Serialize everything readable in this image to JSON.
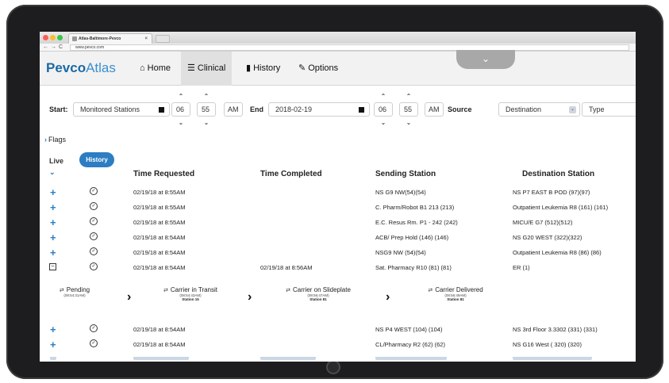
{
  "browser": {
    "tab_title": "Atlas-Baltimore-Pevco",
    "url": "www.pevco.com"
  },
  "app": {
    "logo_main": "Pevco",
    "logo_sub": "Atlas",
    "nav": [
      {
        "label": "Home",
        "icon": "home-icon"
      },
      {
        "label": "Clinical",
        "icon": "list-icon"
      },
      {
        "label": "History",
        "icon": "bar-chart-icon"
      },
      {
        "label": "Options",
        "icon": "wrench-icon"
      }
    ],
    "active_nav": "Clinical"
  },
  "filters": {
    "start_label": "Start:",
    "start_value": "Monitored Stations",
    "start_hour": "06",
    "start_minute": "55",
    "start_ampm": "AM",
    "end_label": "End",
    "end_value": "2018-02-19",
    "end_hour": "06",
    "end_minute": "55",
    "end_ampm": "AM",
    "source_label": "Source",
    "destination_value": "Destination",
    "type_value": "Type"
  },
  "flags_label": "Flags",
  "view_tabs": {
    "live": "Live",
    "history": "History"
  },
  "columns": [
    "Time Requested",
    "Time Completed",
    "Sending Station",
    "Destination Station"
  ],
  "rows": [
    {
      "expand": "+",
      "time_requested": "02/19/18 at 8:55AM",
      "time_completed": "",
      "sending": "NS G9 NW(54)(54)",
      "destination": "NS P7 EAST B POD (97)(97)"
    },
    {
      "expand": "+",
      "time_requested": "02/19/18 at 8:55AM",
      "time_completed": "",
      "sending": "C. Pharm/Robot B1 213 (213)",
      "destination": "Outpatient Leukemia R8 (161) (161)"
    },
    {
      "expand": "+",
      "time_requested": "02/19/18 at 8:55AM",
      "time_completed": "",
      "sending": "E.C. Resus Rm. P1 - 242 (242)",
      "destination": "MICU/E G7 (512)(512)"
    },
    {
      "expand": "+",
      "time_requested": "02/19/18 at 8:54AM",
      "time_completed": "",
      "sending": "ACB/ Prep Hold (146) (146)",
      "destination": "NS G20 WEST (322)(322)"
    },
    {
      "expand": "+",
      "time_requested": "02/19/18 at 8:54AM",
      "time_completed": "",
      "sending": "NSG9 NW (54)(54)",
      "destination": "Outpatient Leukemia R8 (86) (86)"
    },
    {
      "expand": "-",
      "time_requested": "02/19/18 at 8:54AM",
      "time_completed": "02/19/18 at 8:56AM",
      "sending": "Sat. Pharmacy R10 (81) (81)",
      "destination": "ER (1)"
    }
  ],
  "tracking_steps": [
    {
      "label": "Pending",
      "time": "(08:54:31AM)",
      "station": ""
    },
    {
      "label": "Carrier in Transit",
      "time": "(08:54:43AM)",
      "station": "Station 15"
    },
    {
      "label": "Carrier on Slideplate",
      "time": "(08:56:47AM)",
      "station": "Station 81"
    },
    {
      "label": "Carrier Delivered",
      "time": "(08:56:49AM)",
      "station": "Station 81"
    }
  ],
  "rows_after": [
    {
      "expand": "+",
      "time_requested": "02/19/18 at 8:54AM",
      "time_completed": "",
      "sending": "NS P4 WEST (104) (104)",
      "destination": "NS 3rd Floor 3.3302 (331) (331)"
    },
    {
      "expand": "+",
      "time_requested": "02/19/18 at 8:54AM",
      "time_completed": "",
      "sending": "CL/Pharmacy R2 (62) (62)",
      "destination": "NS G16 West ( 320) (320)"
    }
  ],
  "colors": {
    "accent": "#2d7dc2",
    "bezel": "#1d1d1f",
    "header_bg": "#f2f2f2"
  }
}
